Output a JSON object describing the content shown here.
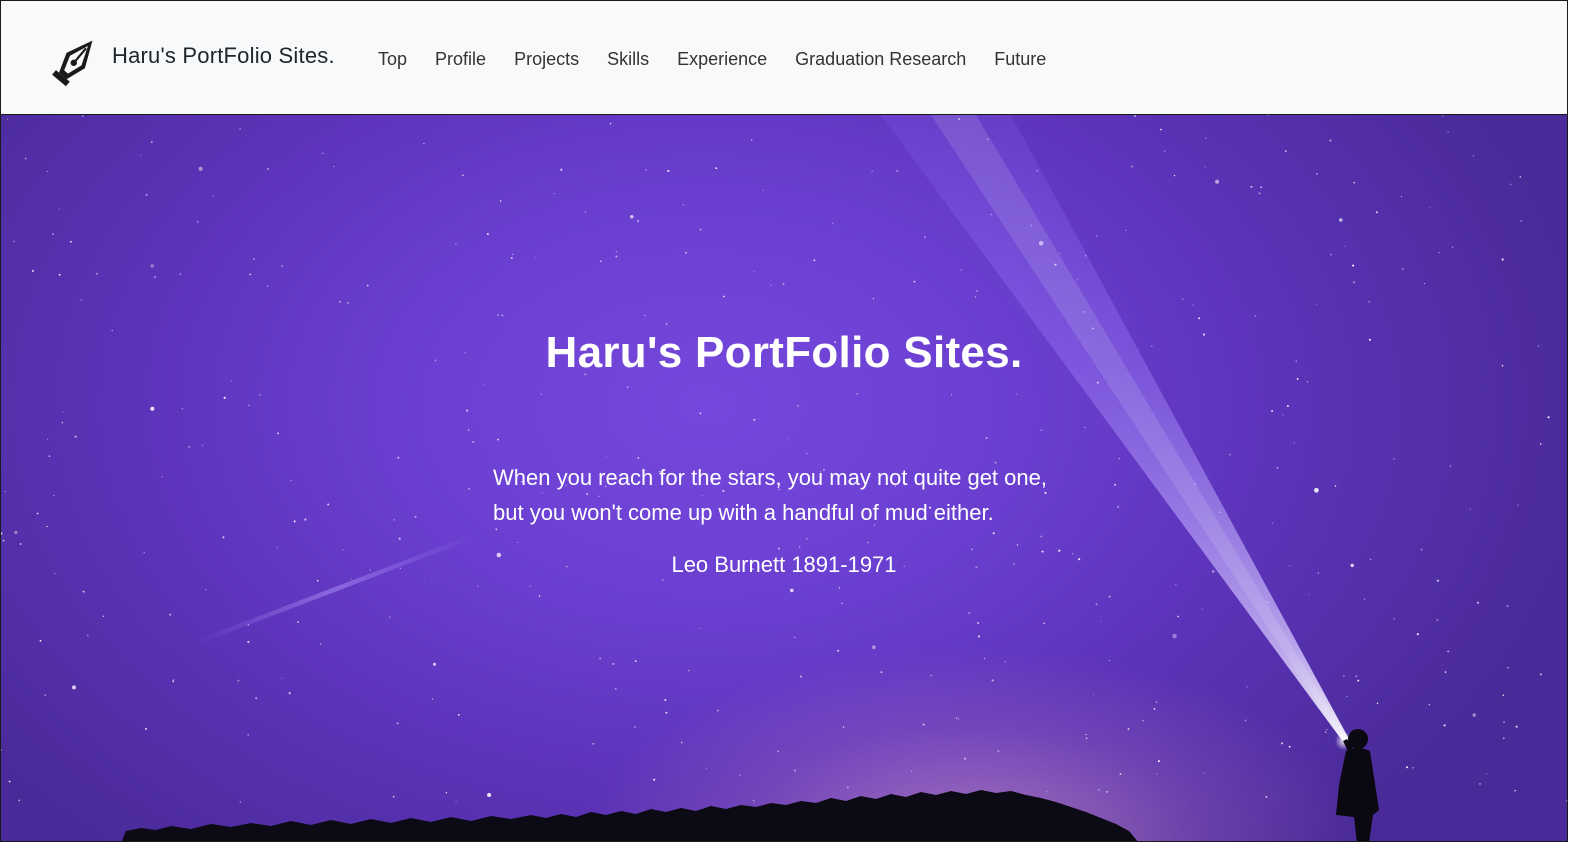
{
  "navbar": {
    "brand_text": "Haru's PortFolio Sites.",
    "brand_icon": "pen-nib-icon",
    "links": [
      {
        "label": "Top"
      },
      {
        "label": "Profile"
      },
      {
        "label": "Projects"
      },
      {
        "label": "Skills"
      },
      {
        "label": "Experience"
      },
      {
        "label": "Graduation Research"
      },
      {
        "label": "Future"
      }
    ]
  },
  "hero": {
    "title": "Haru's PortFolio Sites.",
    "quote_lines": [
      "When you reach for the stars, you may not quite get one,",
      "but you won't come up with a handful of mud either."
    ],
    "author": "Leo Burnett 1891-1971",
    "colors": {
      "sky": "#6a3fd0",
      "beam": "#b9a2ff",
      "text": "#ffffff"
    }
  }
}
